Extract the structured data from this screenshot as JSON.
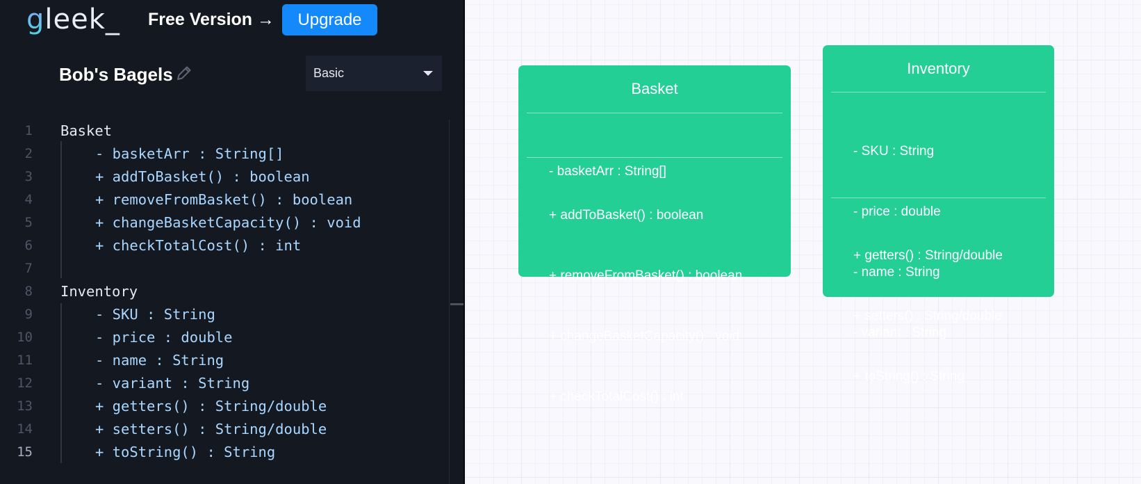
{
  "header": {
    "logo_text": "gleek_",
    "free_version_label": "Free Version →",
    "upgrade_label": "Upgrade"
  },
  "document": {
    "title": "Bob's Bagels",
    "edit_icon": "pencil-icon",
    "diagram_style": "Basic"
  },
  "editor": {
    "active_line": 15,
    "lines": [
      {
        "no": "1",
        "text": "Basket"
      },
      {
        "no": "2",
        "text": "- basketArr : String[]"
      },
      {
        "no": "3",
        "text": "+ addToBasket() : boolean"
      },
      {
        "no": "4",
        "text": "+ removeFromBasket() : boolean"
      },
      {
        "no": "5",
        "text": "+ changeBasketCapacity() : void"
      },
      {
        "no": "6",
        "text": "+ checkTotalCost() : int"
      },
      {
        "no": "7",
        "text": ""
      },
      {
        "no": "8",
        "text": "Inventory"
      },
      {
        "no": "9",
        "text": "- SKU : String"
      },
      {
        "no": "10",
        "text": "- price : double"
      },
      {
        "no": "11",
        "text": "- name : String"
      },
      {
        "no": "12",
        "text": "- variant : String"
      },
      {
        "no": "13",
        "text": "+ getters() : String/double"
      },
      {
        "no": "14",
        "text": "+ setters() : String/double"
      },
      {
        "no": "15",
        "text": "+ toString() : String"
      }
    ]
  },
  "diagram": {
    "box_color": "#23cf94",
    "classes": [
      {
        "name": "Basket",
        "attributes": [
          "- basketArr : String[]"
        ],
        "methods": [
          "+ addToBasket() : boolean",
          "+ removeFromBasket() : boolean",
          "+ changeBasketCapacity() : void",
          "+ checkTotalCost() : int"
        ]
      },
      {
        "name": "Inventory",
        "attributes": [
          "- SKU : String",
          "- price : double",
          "- name : String",
          "- variant : String"
        ],
        "methods": [
          "+ getters() : String/double",
          "+ setters() : String/double",
          "+ toString() : String"
        ]
      }
    ]
  }
}
